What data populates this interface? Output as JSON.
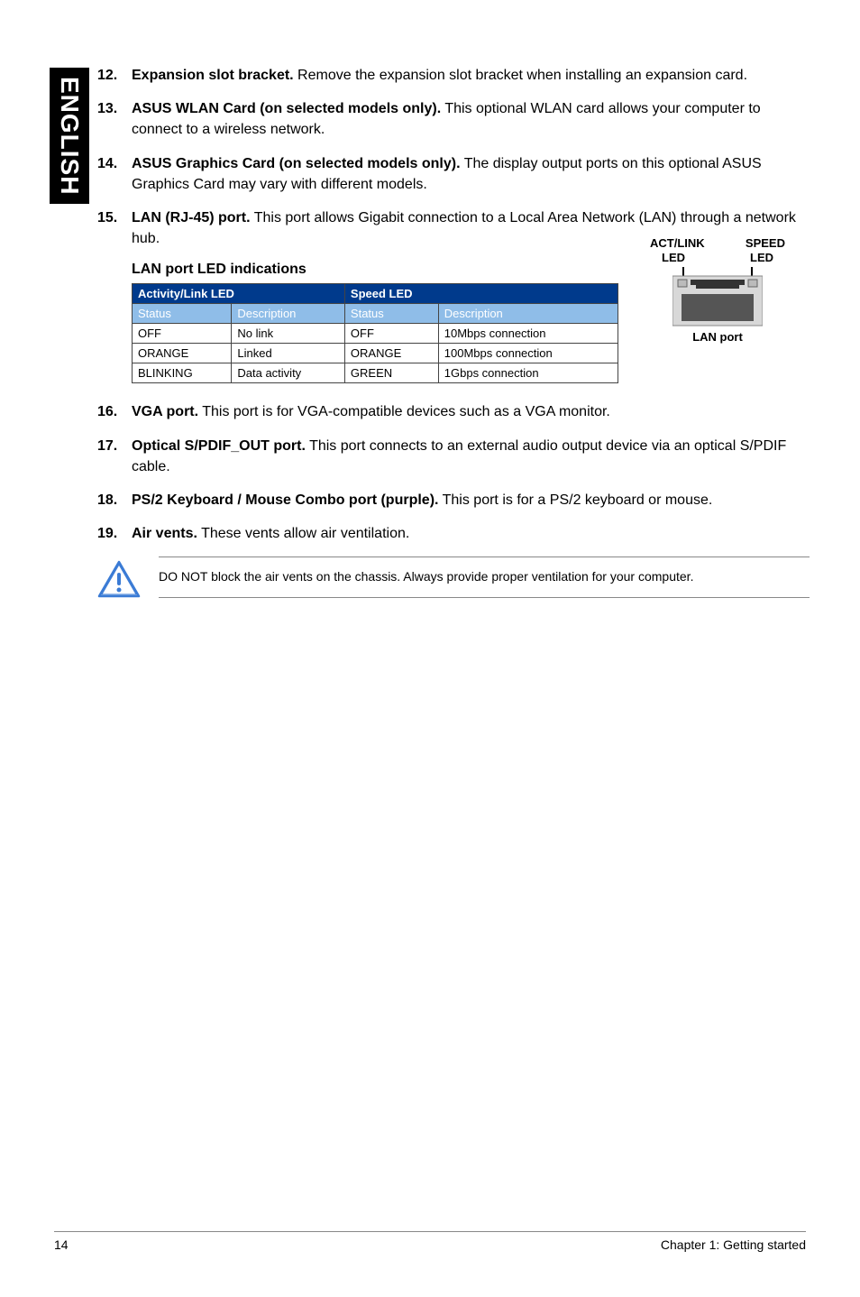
{
  "sidebar": {
    "language": "ENGLISH"
  },
  "items": [
    {
      "num": "12.",
      "bold": "Expansion slot bracket.",
      "text": " Remove the expansion slot bracket when installing an expansion card."
    },
    {
      "num": "13.",
      "bold": "ASUS WLAN Card (on selected models only).",
      "text": " This optional WLAN card allows your computer to connect to a wireless network."
    },
    {
      "num": "14.",
      "bold": "ASUS Graphics Card (on selected models only).",
      "text": " The display output ports on this optional ASUS Graphics Card may vary with different models."
    },
    {
      "num": "15.",
      "bold": "LAN (RJ-45) port.",
      "text": " This port allows Gigabit connection to a Local Area Network (LAN) through a network hub."
    }
  ],
  "led_section": {
    "heading": "LAN port LED indications",
    "table": {
      "header1": [
        "Activity/Link LED",
        "Speed LED"
      ],
      "header2": [
        "Status",
        "Description",
        "Status",
        "Description"
      ],
      "rows": [
        [
          "OFF",
          "No link",
          "OFF",
          "10Mbps connection"
        ],
        [
          "ORANGE",
          "Linked",
          "ORANGE",
          "100Mbps connection"
        ],
        [
          "BLINKING",
          "Data activity",
          "GREEN",
          "1Gbps connection"
        ]
      ]
    },
    "diagram": {
      "top_left": "ACT/LINK",
      "top_right": "SPEED",
      "led_left": "LED",
      "led_right": "LED",
      "bottom": "LAN port"
    }
  },
  "items2": [
    {
      "num": "16.",
      "bold": "VGA port.",
      "text": " This port is for VGA-compatible devices such as a VGA monitor."
    },
    {
      "num": "17.",
      "bold": "Optical S/PDIF_OUT port.",
      "text": " This port connects to an external audio output device via an optical S/PDIF cable."
    },
    {
      "num": "18.",
      "bold": "PS/2 Keyboard / Mouse Combo port (purple).",
      "text": " This port is for a PS/2 keyboard or mouse."
    },
    {
      "num": "19.",
      "bold": "Air vents.",
      "text": " These vents allow air ventilation."
    }
  ],
  "note": {
    "text": "DO NOT block the air vents on the chassis. Always provide proper ventilation for your computer."
  },
  "footer": {
    "page": "14",
    "chapter": "Chapter 1: Getting started"
  }
}
